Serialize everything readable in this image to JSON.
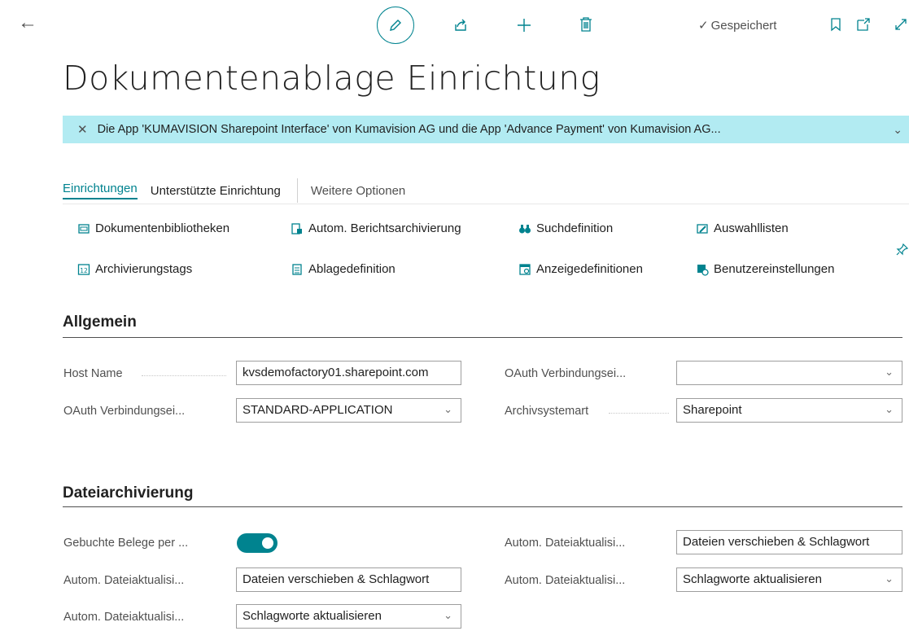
{
  "toolbar": {
    "back_icon": "back-arrow-icon",
    "edit_icon": "pencil-icon",
    "share_icon": "share-icon",
    "new_icon": "plus-icon",
    "delete_icon": "trash-icon",
    "saved_label": "Gespeichert",
    "bookmark_icon": "bookmark-icon",
    "open_new_window_icon": "open-new-window-icon",
    "expand_icon": "expand-icon"
  },
  "page_title": "Dokumentenablage Einrichtung",
  "banner": {
    "text": "Die App 'KUMAVISION Sharepoint Interface' von Kumavision AG und die App 'Advance Payment' von Kumavision AG...",
    "color": "#b2ebf2"
  },
  "tabs": [
    {
      "label": "Einrichtungen",
      "active": true
    },
    {
      "label": "Unterstützte Einrichtung"
    },
    {
      "label": "Weitere Optionen"
    }
  ],
  "actions": [
    {
      "label": "Dokumentenbibliotheken",
      "icon": "library-icon"
    },
    {
      "label": "Autom. Berichtsarchivierung",
      "icon": "report-archive-icon"
    },
    {
      "label": "Suchdefinition",
      "icon": "binoculars-icon"
    },
    {
      "label": "Auswahllisten",
      "icon": "list-edit-icon"
    },
    {
      "label": "Archivierungstags",
      "icon": "tag-calendar-icon"
    },
    {
      "label": "Ablagedefinition",
      "icon": "filing-icon"
    },
    {
      "label": "Anzeigedefinitionen",
      "icon": "display-icon"
    },
    {
      "label": "Benutzereinstellungen",
      "icon": "user-settings-icon"
    }
  ],
  "pin_icon": "pin-icon",
  "sections": {
    "general": {
      "title": "Allgemein",
      "host_name_label": "Host Name",
      "host_name_value": "kvsdemofactory01.sharepoint.com",
      "oauth_label_left": "OAuth Verbindungsei...",
      "oauth_value_left": "STANDARD-APPLICATION",
      "oauth_label_right": "OAuth Verbindungsei...",
      "oauth_value_right": "",
      "archive_type_label": "Archivsystemart",
      "archive_type_value": "Sharepoint"
    },
    "file_archiving": {
      "title": "Dateiarchivierung",
      "posted_docs_label": "Gebuchte Belege per ...",
      "posted_docs_enabled": true,
      "auto_update_label_1": "Autom. Dateiaktualisi...",
      "auto_update_value_1": "Dateien verschieben & Schlagwort",
      "auto_update_label_2": "Autom. Dateiaktualisi...",
      "auto_update_value_2": "Schlagworte aktualisieren",
      "auto_update_label_3": "Autom. Dateiaktualisi...",
      "auto_update_value_3": "Dateien verschieben & Schlagwort",
      "auto_update_label_4": "Autom. Dateiaktualisi...",
      "auto_update_value_4": "Schlagworte aktualisieren"
    }
  },
  "colors": {
    "accent": "#00838f",
    "banner": "#b2ebf2"
  }
}
